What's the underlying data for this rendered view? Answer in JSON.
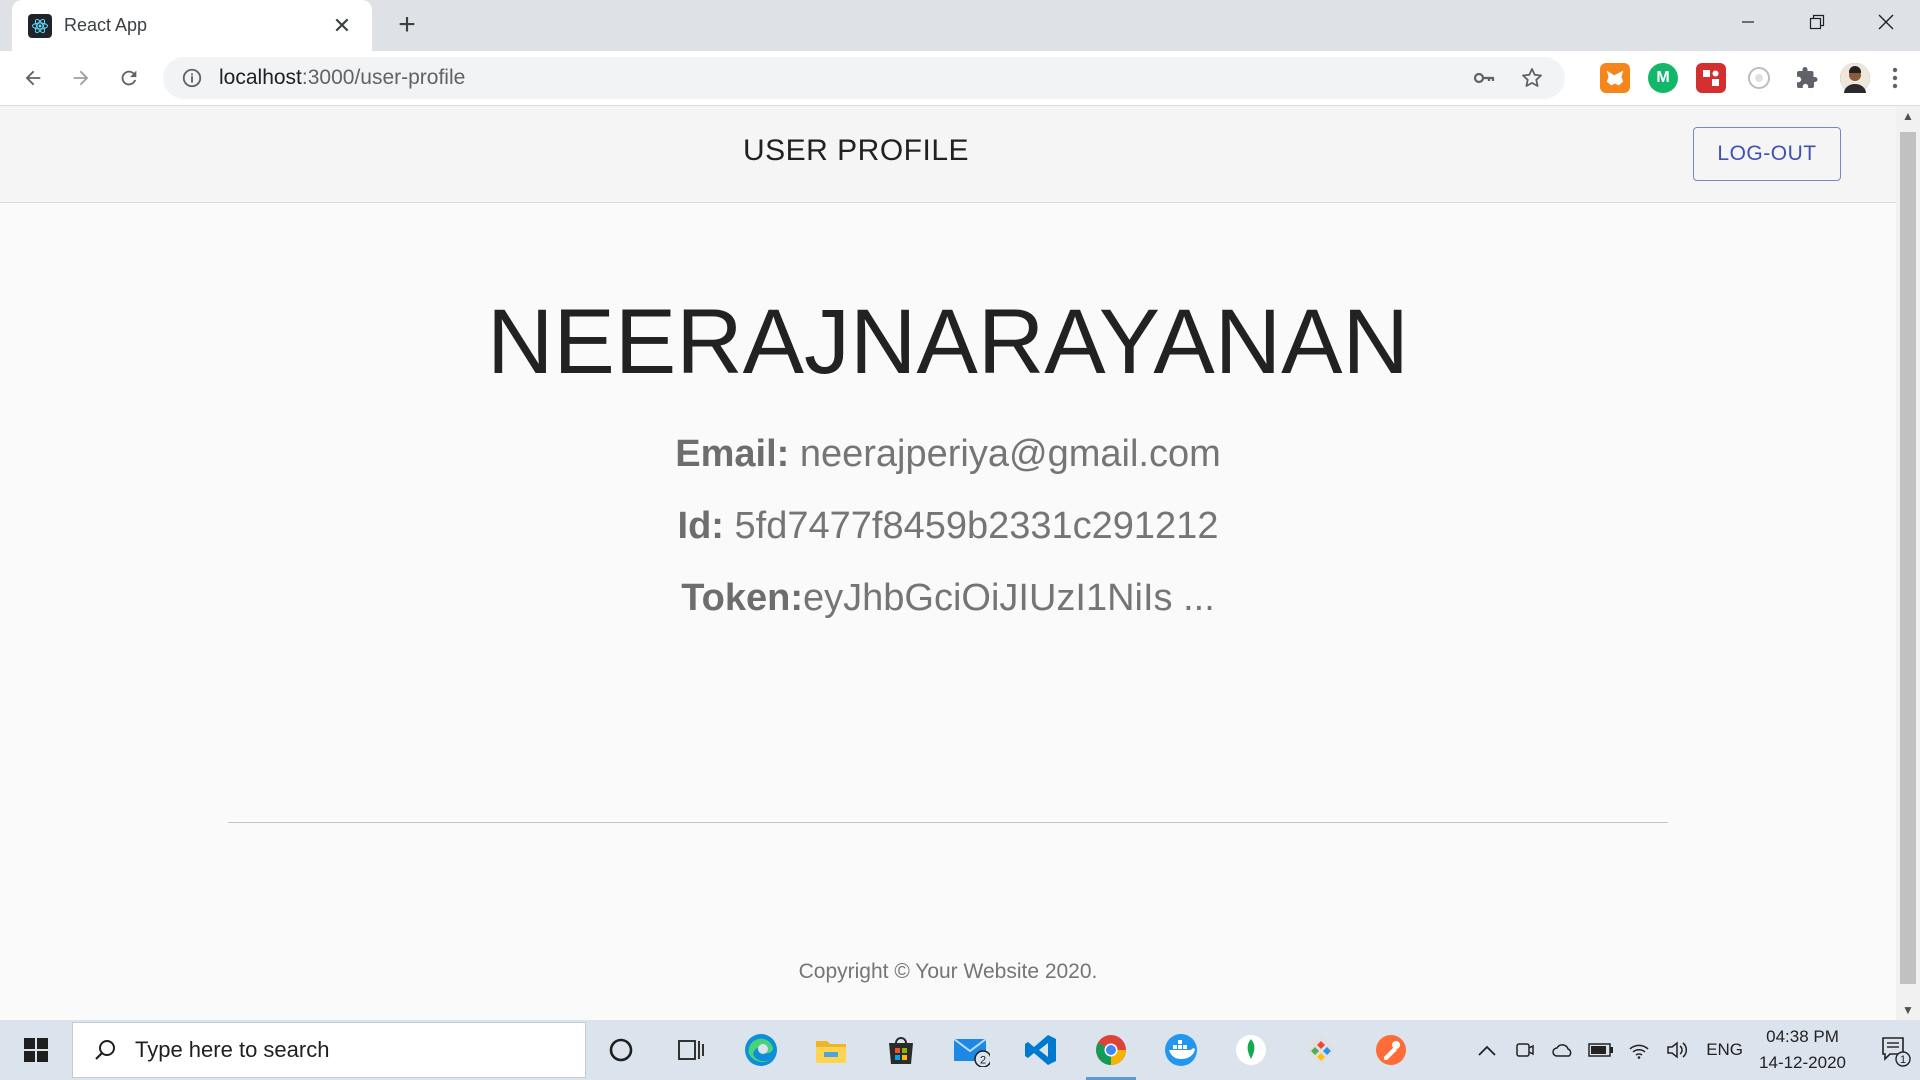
{
  "browser": {
    "tab_title": "React App",
    "url_host": "localhost",
    "url_path": ":3000/user-profile"
  },
  "header": {
    "title": "USER PROFILE",
    "logout_label": "LOG-OUT"
  },
  "profile": {
    "name": "NEERAJNARAYANAN",
    "email_label": "Email:",
    "email_value": " neerajperiya@gmail.com",
    "id_label": "Id:",
    "id_value": " 5fd7477f8459b2331c291212",
    "token_label": "Token:",
    "token_value": "eyJhbGciOiJIUzI1NiIs ..."
  },
  "footer": {
    "copyright": "Copyright © Your Website 2020."
  },
  "taskbar": {
    "search_placeholder": "Type here to search",
    "mail_badge": "2",
    "language": "ENG",
    "time": "04:38 PM",
    "date": "14-12-2020",
    "notification_count": "1"
  },
  "colors": {
    "accent": "#3f51b5",
    "page_bg": "#fafafa",
    "header_bg": "#f5f5f5"
  }
}
